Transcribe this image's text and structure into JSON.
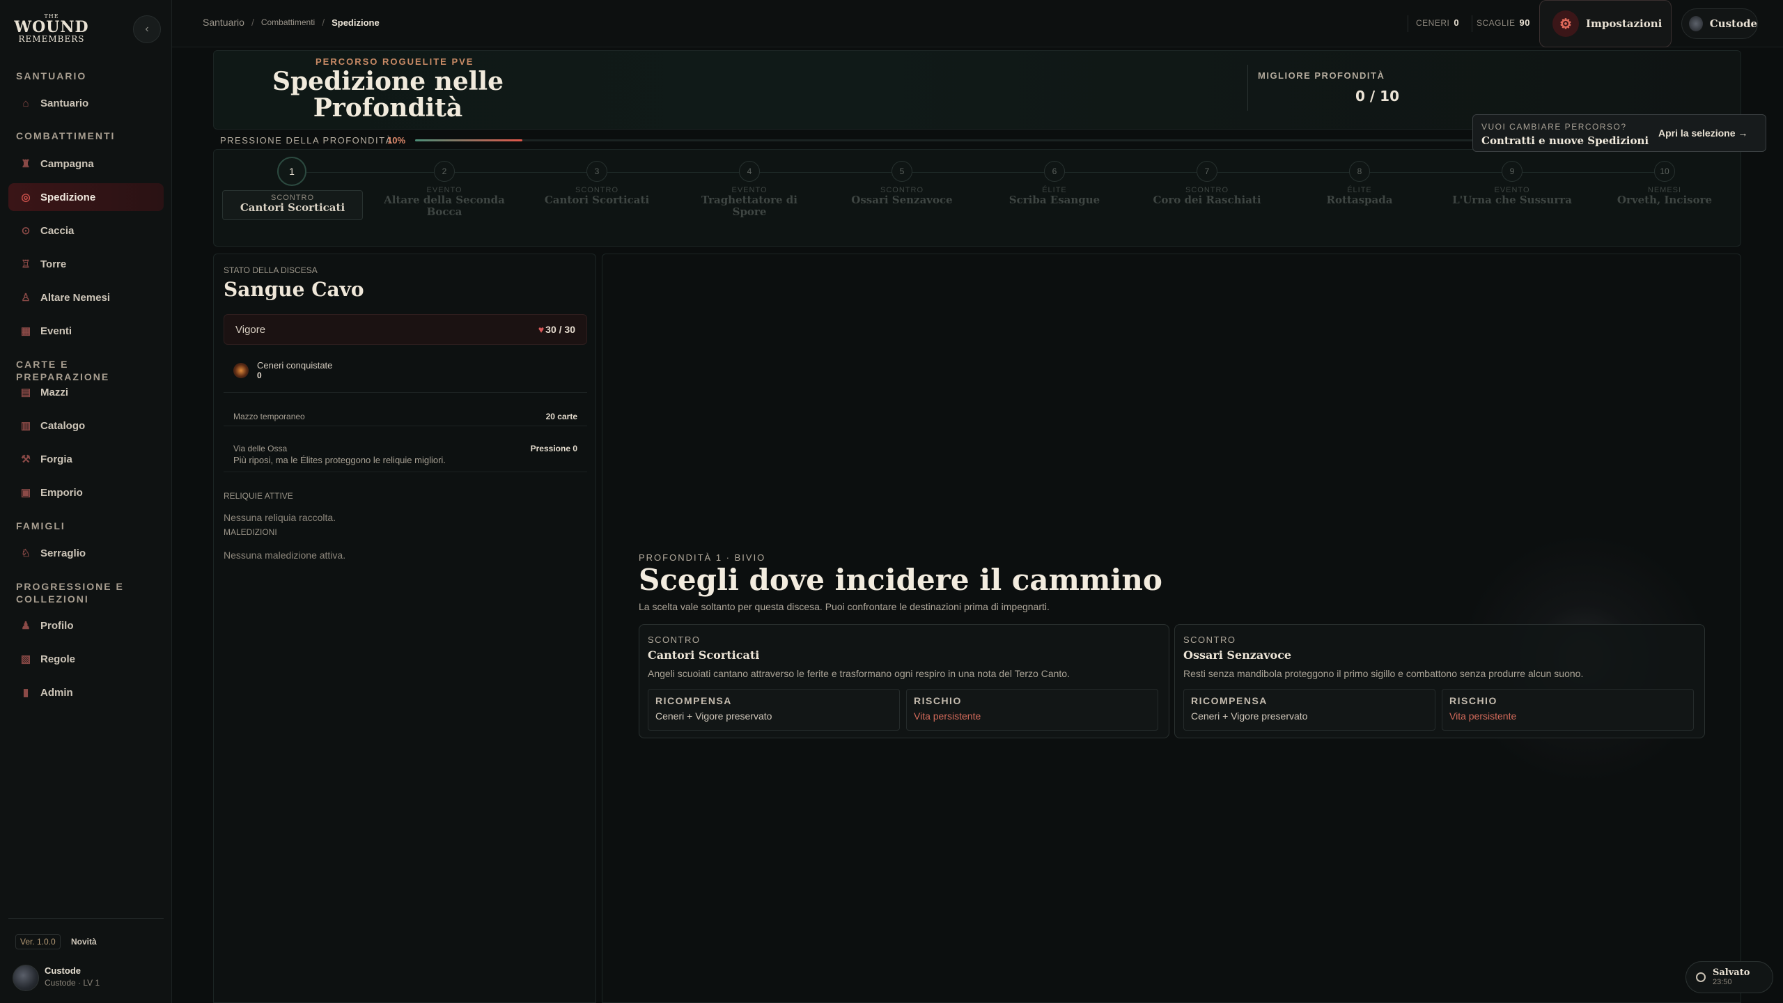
{
  "logo": {
    "line1": "THE",
    "line2": "WOUND",
    "line3": "REMEMBERS"
  },
  "sidebar": {
    "collapse_icon": "chevron-left-icon",
    "sections": [
      {
        "title": "SANTUARIO",
        "items": [
          {
            "label": "Santuario",
            "icon": "temple-icon"
          }
        ]
      },
      {
        "title": "COMBATTIMENTI",
        "items": [
          {
            "label": "Campagna",
            "icon": "castle-icon"
          },
          {
            "label": "Spedizione",
            "icon": "compass-icon",
            "active": true
          },
          {
            "label": "Caccia",
            "icon": "target-icon"
          },
          {
            "label": "Torre",
            "icon": "tower-icon"
          },
          {
            "label": "Altare Nemesi",
            "icon": "altar-icon"
          },
          {
            "label": "Eventi",
            "icon": "calendar-icon"
          }
        ]
      },
      {
        "title": "CARTE E PREPARAZIONE",
        "items": [
          {
            "label": "Mazzi",
            "icon": "cards-icon"
          },
          {
            "label": "Catalogo",
            "icon": "book-icon"
          },
          {
            "label": "Forgia",
            "icon": "hammer-icon"
          },
          {
            "label": "Emporio",
            "icon": "shop-icon"
          }
        ]
      },
      {
        "title": "FAMIGLI",
        "items": [
          {
            "label": "Serraglio",
            "icon": "creature-icon"
          }
        ]
      },
      {
        "title": "PROGRESSIONE E COLLEZIONI",
        "items": [
          {
            "label": "Profilo",
            "icon": "user-icon"
          },
          {
            "label": "Regole",
            "icon": "scroll-icon"
          },
          {
            "label": "Admin",
            "icon": "chart-icon"
          }
        ]
      }
    ],
    "version": "Ver. 1.0.0",
    "news": "Novità",
    "user": {
      "name": "Custode",
      "sub": "Custode · LV 1"
    }
  },
  "topbar": {
    "breadcrumb": [
      "Santuario",
      "Combattimenti",
      "Spedizione"
    ],
    "resources": [
      {
        "label": "CENERI",
        "value": "0"
      },
      {
        "label": "SCAGLIE",
        "value": "90"
      }
    ],
    "settings_label": "Impostazioni",
    "user_label": "Custode"
  },
  "header": {
    "kicker": "PERCORSO ROGUELITE PVE",
    "title": "Spedizione nelle Profondità",
    "best_label": "MIGLIORE PROFONDITÀ",
    "best_value": "0 / 10",
    "pressure_label": "PRESSIONE DELLA PROFONDITÀ",
    "pressure_value": "10%",
    "pressure_fraction": 0.1
  },
  "route_card": {
    "question": "VUOI CAMBIARE PERCORSO?",
    "title": "Contratti e nuove Spedizioni",
    "link": "Apri la selezione →"
  },
  "steps": [
    {
      "num": "1",
      "type": "SCONTRO",
      "name": "Cantori Scorticati",
      "current": true
    },
    {
      "num": "2",
      "type": "EVENTO",
      "name": "Altare della Seconda Bocca"
    },
    {
      "num": "3",
      "type": "SCONTRO",
      "name": "Cantori Scorticati"
    },
    {
      "num": "4",
      "type": "EVENTO",
      "name": "Traghettatore di Spore"
    },
    {
      "num": "5",
      "type": "SCONTRO",
      "name": "Ossari Senzavoce"
    },
    {
      "num": "6",
      "type": "ÉLITE",
      "name": "Scriba Esangue"
    },
    {
      "num": "7",
      "type": "SCONTRO",
      "name": "Coro dei Raschiati"
    },
    {
      "num": "8",
      "type": "ÉLITE",
      "name": "Rottaspada"
    },
    {
      "num": "9",
      "type": "EVENTO",
      "name": "L'Urna che Sussurra"
    },
    {
      "num": "10",
      "type": "NEMESI",
      "name": "Orveth, Incisore"
    }
  ],
  "status": {
    "kicker": "STATO DELLA DISCESA",
    "title": "Sangue Cavo",
    "vigor_label": "Vigore",
    "vigor_value": "30 / 30",
    "ashes_label": "Ceneri conquistate",
    "ashes_value": "0",
    "deck_label": "Mazzo temporaneo",
    "deck_value": "20 carte",
    "path_label": "Via delle Ossa",
    "path_value": "Pressione 0",
    "path_desc": "Più riposi, ma le Élites proteggono le reliquie migliori.",
    "relics_title": "RELIQUIE ATTIVE",
    "relics_empty": "Nessuna reliquia raccolta.",
    "curses_title": "MALEDIZIONI",
    "curses_empty": "Nessuna maledizione attiva."
  },
  "main": {
    "kicker": "PROFONDITÀ 1 · BIVIO",
    "title": "Scegli dove incidere il cammino",
    "subtitle": "La scelta vale soltanto per questa discesa. Puoi confrontare le destinazioni prima di impegnarti.",
    "choices": [
      {
        "type": "SCONTRO",
        "name": "Cantori Scorticati",
        "desc": "Angeli scuoiati cantano attraverso le ferite e trasformano ogni respiro in una nota del Terzo Canto.",
        "reward_label": "RICOMPENSA",
        "reward": "Ceneri + Vigore preservato",
        "risk_label": "RISCHIO",
        "risk": "Vita persistente"
      },
      {
        "type": "SCONTRO",
        "name": "Ossari Senzavoce",
        "desc": "Resti senza mandibola proteggono il primo sigillo e combattono senza produrre alcun suono.",
        "reward_label": "RICOMPENSA",
        "reward": "Ceneri + Vigore preservato",
        "risk_label": "RISCHIO",
        "risk": "Vita persistente"
      }
    ]
  },
  "saved": {
    "label": "Salvato",
    "time": "23:50"
  },
  "colors": {
    "accent": "#c9504a",
    "risk": "#d26a5a",
    "pressure_start": "#4c8e78",
    "pressure_end": "#e0574a"
  }
}
